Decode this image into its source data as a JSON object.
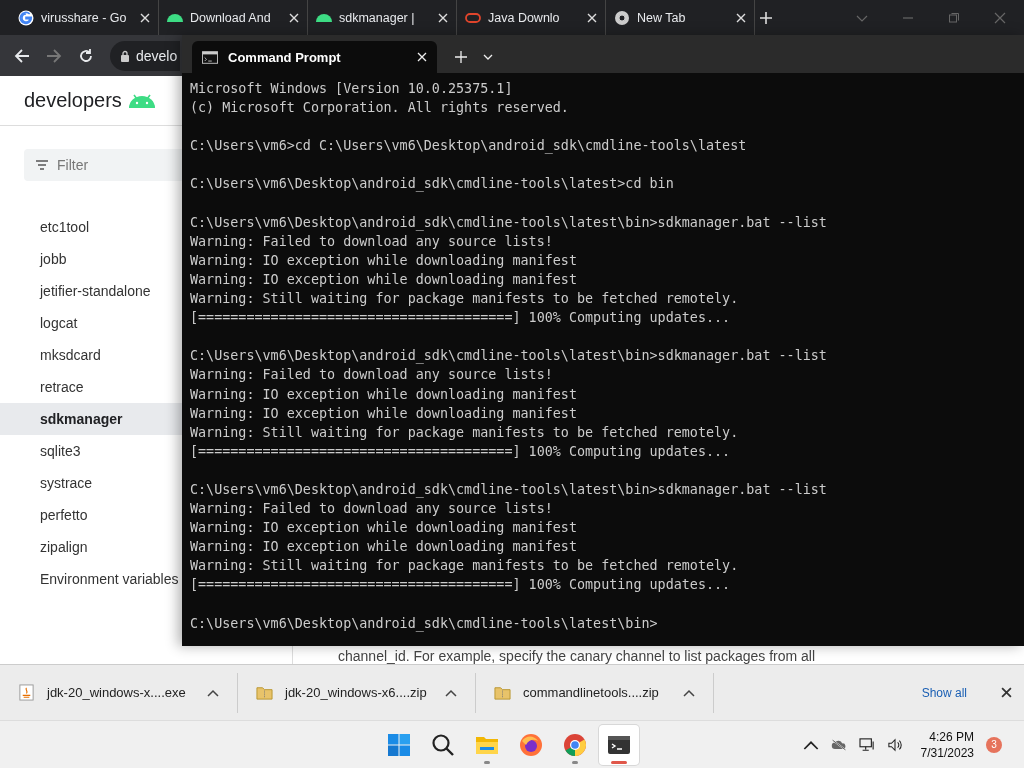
{
  "browser": {
    "tabs": [
      {
        "title": "virusshare - Go",
        "kind": "google"
      },
      {
        "title": "Download And",
        "kind": "android"
      },
      {
        "title": "sdkmanager |",
        "kind": "android"
      },
      {
        "title": "Java Downlo",
        "kind": "oracle"
      },
      {
        "title": "New Tab",
        "kind": "chrome"
      }
    ],
    "address": "develo",
    "logo": "developers",
    "filter": {
      "placeholder": "Filter"
    },
    "nav_items": [
      {
        "label": "etc1tool",
        "selected": false
      },
      {
        "label": "jobb",
        "selected": false
      },
      {
        "label": "jetifier-standalone",
        "selected": false
      },
      {
        "label": "logcat",
        "selected": false
      },
      {
        "label": "mksdcard",
        "selected": false
      },
      {
        "label": "retrace",
        "selected": false
      },
      {
        "label": "sdkmanager",
        "selected": true
      },
      {
        "label": "sqlite3",
        "selected": false
      },
      {
        "label": "systrace",
        "selected": false
      },
      {
        "label": "perfetto",
        "selected": false
      },
      {
        "label": "zipalign",
        "selected": false
      },
      {
        "label": "Environment variables",
        "selected": false
      }
    ],
    "content_text": "channel_id. For example, specify the canary channel to list packages from all"
  },
  "terminal": {
    "tab_title": "Command Prompt",
    "blocks": [
      [
        "Microsoft Windows [Version 10.0.25375.1]",
        "(c) Microsoft Corporation. All rights reserved."
      ],
      [
        "C:\\Users\\vm6>cd C:\\Users\\vm6\\Desktop\\android_sdk\\cmdline-tools\\latest"
      ],
      [
        "C:\\Users\\vm6\\Desktop\\android_sdk\\cmdline-tools\\latest>cd bin"
      ],
      [
        "C:\\Users\\vm6\\Desktop\\android_sdk\\cmdline-tools\\latest\\bin>sdkmanager.bat --list",
        "Warning: Failed to download any source lists!",
        "Warning: IO exception while downloading manifest",
        "Warning: IO exception while downloading manifest",
        "Warning: Still waiting for package manifests to be fetched remotely.",
        "[=======================================] 100% Computing updates..."
      ],
      [
        "C:\\Users\\vm6\\Desktop\\android_sdk\\cmdline-tools\\latest\\bin>sdkmanager.bat --list",
        "Warning: Failed to download any source lists!",
        "Warning: IO exception while downloading manifest",
        "Warning: IO exception while downloading manifest",
        "Warning: Still waiting for package manifests to be fetched remotely.",
        "[=======================================] 100% Computing updates..."
      ],
      [
        "C:\\Users\\vm6\\Desktop\\android_sdk\\cmdline-tools\\latest\\bin>sdkmanager.bat --list",
        "Warning: Failed to download any source lists!",
        "Warning: IO exception while downloading manifest",
        "Warning: IO exception while downloading manifest",
        "Warning: Still waiting for package manifests to be fetched remotely.",
        "[=======================================] 100% Computing updates..."
      ],
      [
        "C:\\Users\\vm6\\Desktop\\android_sdk\\cmdline-tools\\latest\\bin>"
      ]
    ]
  },
  "downloads": {
    "items": [
      {
        "name": "jdk-20_windows-x....exe",
        "kind": "java"
      },
      {
        "name": "jdk-20_windows-x6....zip",
        "kind": "zip"
      },
      {
        "name": "commandlinetools....zip",
        "kind": "zip"
      }
    ],
    "show_all": "Show all"
  },
  "taskbar": {
    "apps": [
      {
        "kind": "start",
        "running": false,
        "active": false
      },
      {
        "kind": "search",
        "running": false,
        "active": false
      },
      {
        "kind": "explorer",
        "running": true,
        "active": false
      },
      {
        "kind": "firefox",
        "running": false,
        "active": false
      },
      {
        "kind": "chrome",
        "running": true,
        "active": false
      },
      {
        "kind": "terminal",
        "running": true,
        "active": true
      }
    ],
    "time": "4:26 PM",
    "date": "7/31/2023",
    "notifications": "3"
  }
}
